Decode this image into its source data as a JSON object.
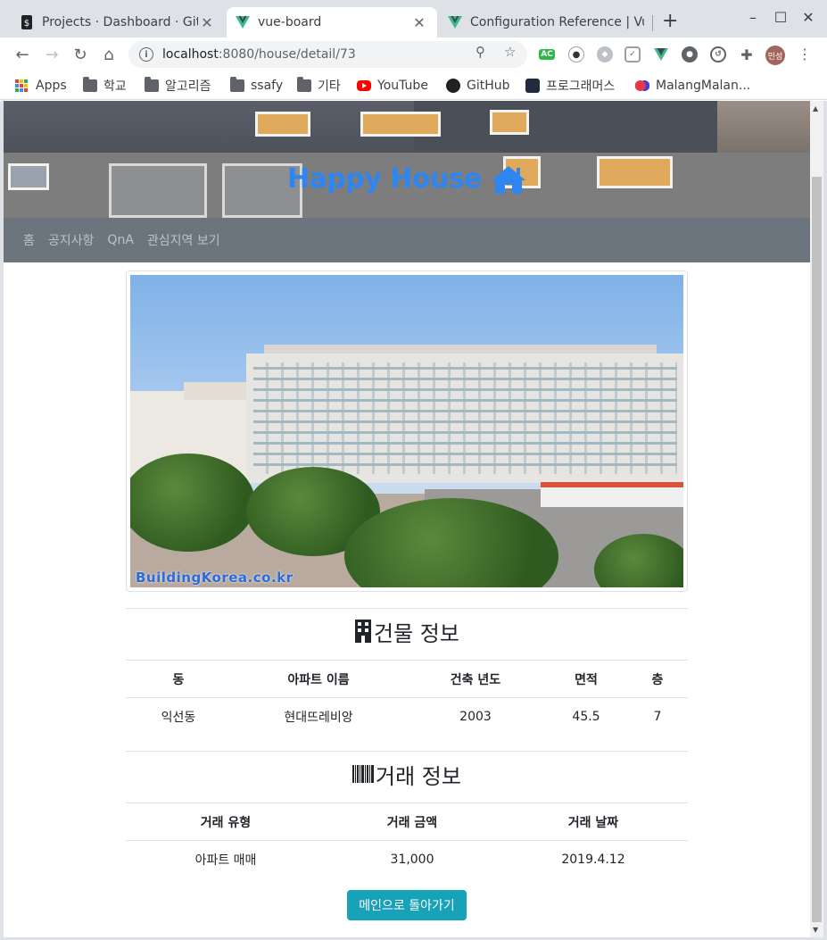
{
  "browser": {
    "tabs": [
      {
        "title": "Projects · Dashboard · GitLab",
        "active": false
      },
      {
        "title": "vue-board",
        "active": true
      },
      {
        "title": "Configuration Reference | Vue CLI",
        "active": false
      }
    ],
    "url": {
      "host": "localhost",
      "path": ":8080/house/detail/73"
    },
    "profile_initials": "민성",
    "bookmarks": [
      "Apps",
      "학교",
      "알고리즘",
      "ssafy",
      "기타",
      "YouTube",
      "GitHub",
      "프로그래머스",
      "MalangMalan..."
    ],
    "ext_ac_label": "AC"
  },
  "site": {
    "brand": "Happy House",
    "nav": [
      "홈",
      "공지사항",
      "QnA",
      "관심지역 보기"
    ],
    "photo_watermark": "BuildingKorea.co.kr"
  },
  "building": {
    "title": "건물 정보",
    "columns": [
      "동",
      "아파트 이름",
      "건축 년도",
      "면적",
      "층"
    ],
    "row": [
      "익선동",
      "현대뜨레비앙",
      "2003",
      "45.5",
      "7"
    ]
  },
  "deal": {
    "title": "거래 정보",
    "columns": [
      "거래 유형",
      "거래 금액",
      "거래 날짜"
    ],
    "row": [
      "아파트 매매",
      "31,000",
      "2019.4.12"
    ]
  },
  "back_button": "메인으로 돌아가기",
  "colors": {
    "brand": "#2f86f0",
    "navbar": "#6c757d",
    "button": "#17a2b8"
  }
}
